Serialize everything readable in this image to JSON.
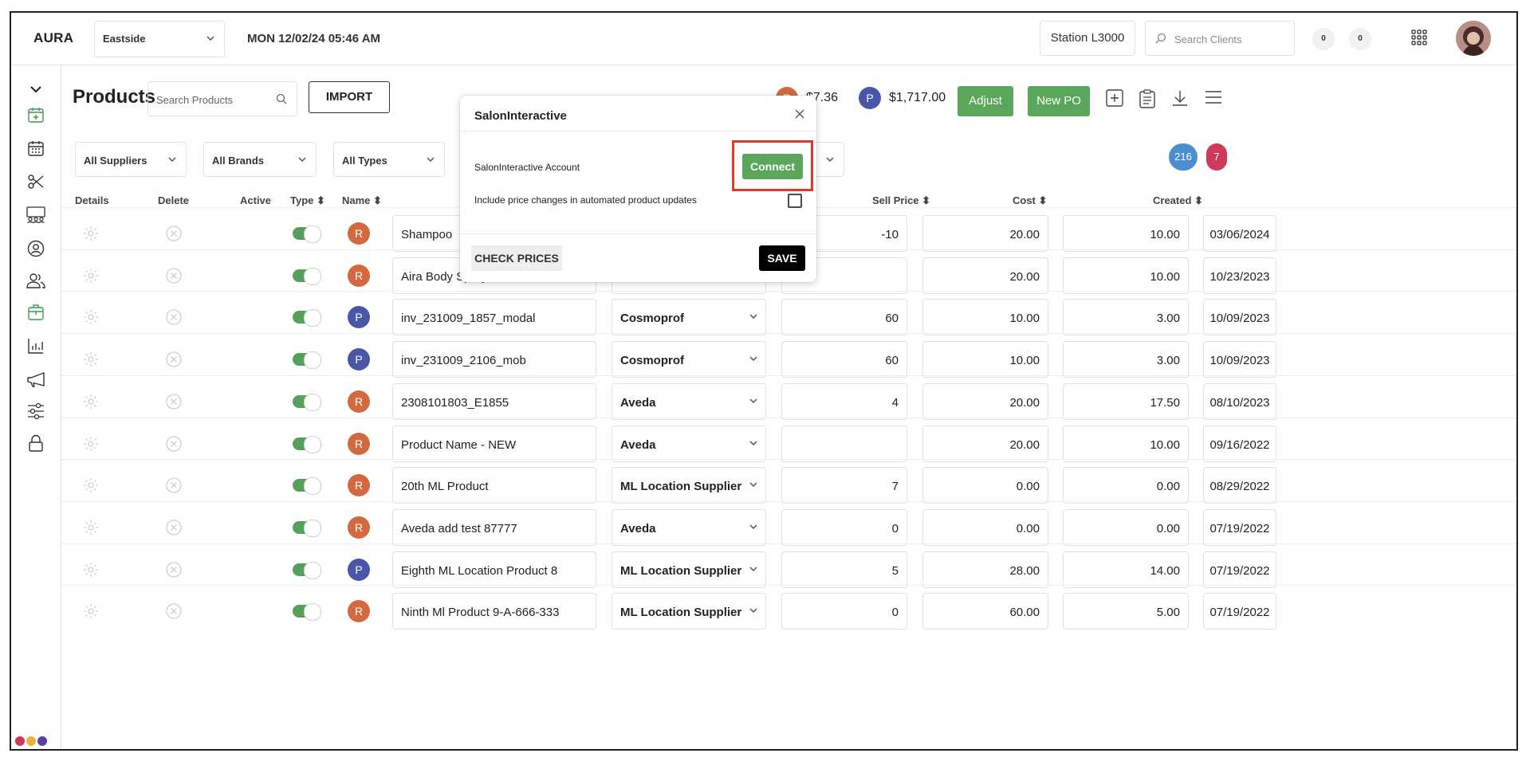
{
  "header": {
    "logo": "AURA",
    "location": "Eastside",
    "datetime": "MON 12/02/24  05:46 AM",
    "station": "Station L3000",
    "search_placeholder": "Search Clients",
    "count_a": "0",
    "count_b": "0"
  },
  "toolbar": {
    "title": "Products",
    "search_placeholder": "Search Products",
    "import_label": "IMPORT",
    "balance_r_badge": "R",
    "balance_r": "$7.36",
    "balance_p_badge": "P",
    "balance_p": "$1,717.00",
    "adjust_label": "Adjust",
    "new_po_label": "New PO"
  },
  "filters": {
    "suppliers": "All Suppliers",
    "brands": "All Brands",
    "types": "All Types",
    "count_total": "216",
    "count_alert": "7"
  },
  "columns": {
    "details": "Details",
    "delete": "Delete",
    "active": "Active",
    "type": "Type",
    "name": "Name",
    "sell_price": "Sell Price",
    "cost": "Cost",
    "created": "Created"
  },
  "rows": [
    {
      "type": "R",
      "name": "Shampoo",
      "supplier": "",
      "qty": "-10",
      "sell": "20.00",
      "cost": "10.00",
      "created": "03/06/2024"
    },
    {
      "type": "R",
      "name": "Aira Body Spray",
      "supplier": "",
      "qty": "",
      "sell": "20.00",
      "cost": "10.00",
      "created": "10/23/2023"
    },
    {
      "type": "P",
      "name": "inv_231009_1857_modal",
      "supplier": "Cosmoprof",
      "qty": "60",
      "sell": "10.00",
      "cost": "3.00",
      "created": "10/09/2023"
    },
    {
      "type": "P",
      "name": "inv_231009_2106_mob",
      "supplier": "Cosmoprof",
      "qty": "60",
      "sell": "10.00",
      "cost": "3.00",
      "created": "10/09/2023"
    },
    {
      "type": "R",
      "name": "2308101803_E1855",
      "supplier": "Aveda",
      "qty": "4",
      "sell": "20.00",
      "cost": "17.50",
      "created": "08/10/2023"
    },
    {
      "type": "R",
      "name": "Product Name - NEW",
      "supplier": "Aveda",
      "qty": "",
      "sell": "20.00",
      "cost": "10.00",
      "created": "09/16/2022"
    },
    {
      "type": "R",
      "name": "20th ML Product",
      "supplier": "ML Location Supplier",
      "qty": "7",
      "sell": "0.00",
      "cost": "0.00",
      "created": "08/29/2022"
    },
    {
      "type": "R",
      "name": "Aveda add test 87777",
      "supplier": "Aveda",
      "qty": "0",
      "sell": "0.00",
      "cost": "0.00",
      "created": "07/19/2022"
    },
    {
      "type": "P",
      "name": "Eighth ML Location Product 8",
      "supplier": "ML Location Supplier",
      "qty": "5",
      "sell": "28.00",
      "cost": "14.00",
      "created": "07/19/2022"
    },
    {
      "type": "R",
      "name": "Ninth Ml Product 9-A-666-333",
      "supplier": "ML Location Supplier",
      "qty": "0",
      "sell": "60.00",
      "cost": "5.00",
      "created": "07/19/2022"
    }
  ],
  "modal": {
    "title": "SalonInteractive",
    "account_label": "SalonInteractive Account",
    "connect_label": "Connect",
    "price_changes_label": "Include price changes in automated product updates",
    "price_changes_checked": false,
    "check_prices_label": "CHECK PRICES",
    "save_label": "SAVE"
  },
  "sidebar": {
    "icons": [
      "collapse-chevron-icon",
      "add-appointment-icon",
      "calendar-icon",
      "scissors-icon",
      "team-icon",
      "user-icon",
      "clients-icon",
      "products-icon",
      "reports-icon",
      "marketing-icon",
      "settings-sliders-icon",
      "lock-icon"
    ]
  },
  "colors": {
    "green": "#5aa65a",
    "type_r": "#d2693f",
    "type_p": "#4a57a8",
    "badge_blue": "#4a8fd0",
    "badge_red": "#d0395a",
    "highlight_red": "#d93a2b"
  }
}
